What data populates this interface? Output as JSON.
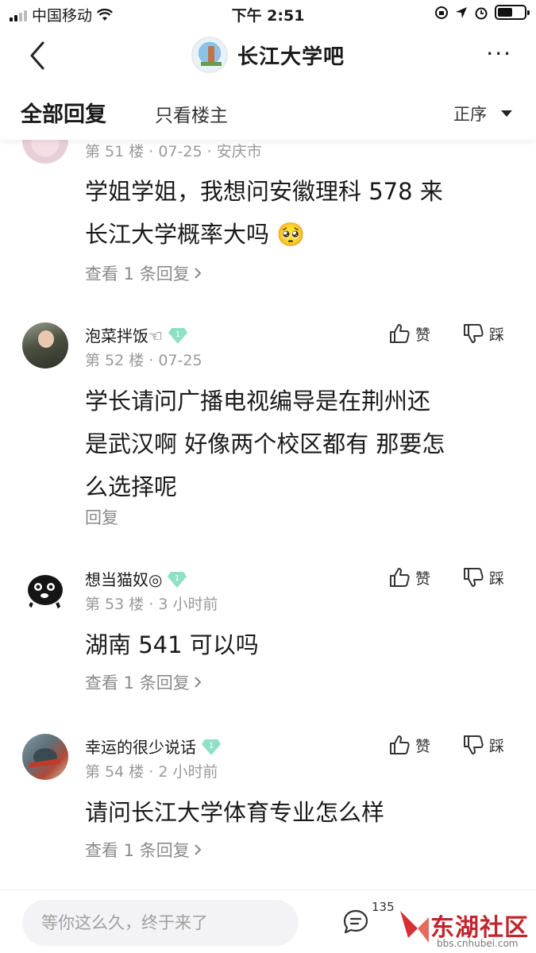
{
  "status_bar": {
    "carrier": "中国移动",
    "time": "下午 2:51"
  },
  "nav": {
    "forum_title": "长江大学吧",
    "more_label": "···"
  },
  "filter": {
    "tab_all": "全部回复",
    "tab_op_only": "只看楼主",
    "sort_label": "正序"
  },
  "posts": [
    {
      "username": "",
      "meta": "第 51 楼 · 07-25 · 安庆市",
      "content_lines": [
        "学姐学姐，我想问安徽理科 578 来",
        "长江大学概率大吗 🥺"
      ],
      "replies_label": "查看 1 条回复"
    },
    {
      "username": "泡菜拌饭☜",
      "level": "1",
      "meta": "第 52 楼 · 07-25",
      "content_lines": [
        "学长请问广播电视编导是在荆州还",
        "是武汉啊 好像两个校区都有 那要怎",
        "么选择呢"
      ],
      "replies_label": "回复",
      "like_label": "赞",
      "dislike_label": "踩"
    },
    {
      "username": "想当猫奴◎",
      "level": "1",
      "meta": "第 53 楼 · 3 小时前",
      "content_lines": [
        "湖南 541 可以吗"
      ],
      "replies_label": "查看 1 条回复",
      "like_label": "赞",
      "dislike_label": "踩"
    },
    {
      "username": "幸运的很少说话",
      "level": "1",
      "meta": "第 54 楼 · 2 小时前",
      "content_lines": [
        "请问长江大学体育专业怎么样"
      ],
      "replies_label": "查看 1 条回复",
      "like_label": "赞",
      "dislike_label": "踩"
    }
  ],
  "bottom_bar": {
    "input_placeholder": "等你这么久，终于来了",
    "comment_count": "135"
  },
  "watermark": {
    "text": "东湖社区",
    "url": "bbs.cnhubei.com"
  },
  "colors": {
    "meta_gray": "#9a9a9a",
    "level_badge": "#8fe0c6",
    "watermark_red": "#c0262d"
  }
}
